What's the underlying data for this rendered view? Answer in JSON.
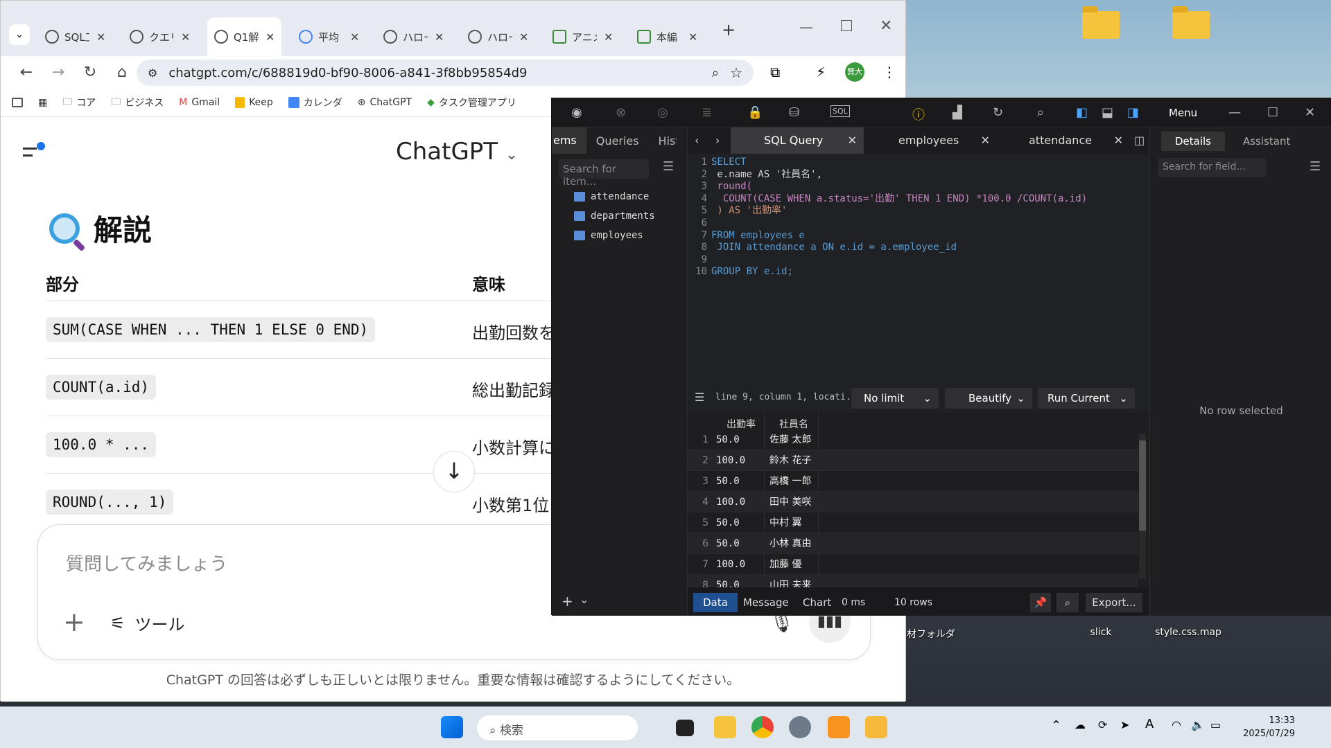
{
  "browser": {
    "tabs": [
      {
        "label": "SQL工"
      },
      {
        "label": "クエリ"
      },
      {
        "label": "Q1解"
      },
      {
        "label": "平均"
      },
      {
        "label": "ハロー"
      },
      {
        "label": "ハロー"
      },
      {
        "label": "アニメ"
      },
      {
        "label": "本編"
      }
    ],
    "url": "chatgpt.com/c/688819d0-bf90-8006-a841-3f8bb95854d9",
    "profile": "賢大",
    "bookmarks": [
      "コア",
      "ビジネス",
      "Gmail",
      "Keep",
      "カレンダ",
      "ChatGPT",
      "タスク管理アプリ"
    ]
  },
  "chat": {
    "model": "ChatGPT",
    "section_title": "解説",
    "col_part": "部分",
    "col_meaning": "意味",
    "rows": [
      {
        "code": "SUM(CASE WHEN ... THEN 1 ELSE 0 END)",
        "meaning": "出勤回数を"
      },
      {
        "code": "COUNT(a.id)",
        "meaning": "総出勤記録"
      },
      {
        "code": "100.0 * ...",
        "meaning": "小数計算に"
      },
      {
        "code": "ROUND(..., 1)",
        "meaning": "小数第1位"
      }
    ],
    "composer_placeholder": "質問してみましょう",
    "tools_label": "ツール",
    "disclaimer": "ChatGPT の回答は必ずしも正しいとは限りません。重要な情報は確認するようにしてください。"
  },
  "sql": {
    "menu_label": "Menu",
    "left_tabs": [
      "ems",
      "Queries",
      "Histo"
    ],
    "search_items_placeholder": "Search for item...",
    "tables": [
      "attendance",
      "departments",
      "employees"
    ],
    "editor_tabs": [
      "SQL Query",
      "employees",
      "attendance"
    ],
    "code_lines": [
      "SELECT",
      " e.name AS '社員名',",
      " round(",
      "  COUNT(CASE WHEN a.status='出勤' THEN 1 END) *100.0 /COUNT(a.id)",
      " ) AS '出勤率'",
      "",
      "FROM employees e",
      " JOIN attendance a ON e.id = a.employee_id",
      "",
      "GROUP BY e.id;"
    ],
    "status_text": "line 9, column 1, locati...",
    "limit_label": "No limit",
    "beautify_label": "Beautify",
    "run_label": "Run Current",
    "result_columns": [
      "出勤率",
      "社員名"
    ],
    "result_rows": [
      {
        "n": "1",
        "rate": "50.0",
        "name": "佐藤 太郎"
      },
      {
        "n": "2",
        "rate": "100.0",
        "name": "鈴木 花子"
      },
      {
        "n": "3",
        "rate": "50.0",
        "name": "高橋 一郎"
      },
      {
        "n": "4",
        "rate": "100.0",
        "name": "田中 美咲"
      },
      {
        "n": "5",
        "rate": "50.0",
        "name": "中村 翼"
      },
      {
        "n": "6",
        "rate": "50.0",
        "name": "小林 真由"
      },
      {
        "n": "7",
        "rate": "100.0",
        "name": "加藤 優"
      },
      {
        "n": "8",
        "rate": "50.0",
        "name": "山田 未来"
      }
    ],
    "bottom_tabs": [
      "Data",
      "Message",
      "Chart"
    ],
    "time": "0 ms",
    "row_count": "10 rows",
    "export_label": "Export...",
    "right_tabs": [
      "Details",
      "Assistant"
    ],
    "search_field_placeholder": "Search for field...",
    "no_row": "No row selected"
  },
  "desktop": {
    "icons": [
      "素材フォルダ",
      "slick",
      "style.css.map"
    ]
  },
  "taskbar": {
    "search_label": "検索",
    "time": "13:33",
    "date": "2025/07/29"
  }
}
